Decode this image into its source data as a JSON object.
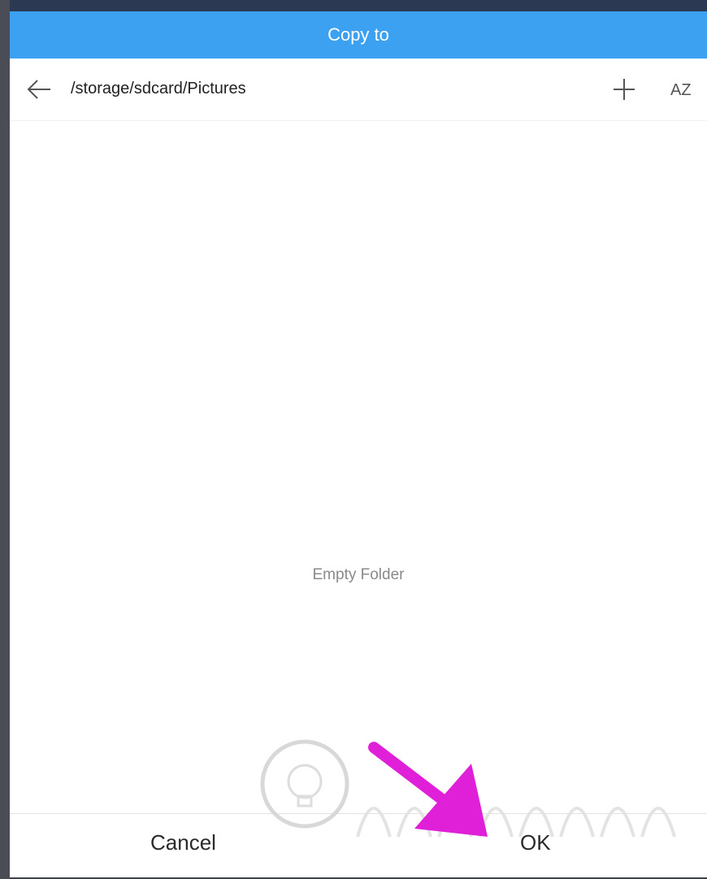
{
  "dialog": {
    "title": "Copy to",
    "path": "/storage/sdcard/Pictures",
    "empty_message": "Empty Folder",
    "sort_glyph": "AZ"
  },
  "icons": {
    "back": "back-arrow-icon",
    "add": "plus-icon",
    "sort": "sort-az-icon"
  },
  "buttons": {
    "cancel": "Cancel",
    "ok": "OK"
  },
  "colors": {
    "title_bar": "#3ba1f0",
    "annotation_arrow": "#e020d8"
  }
}
